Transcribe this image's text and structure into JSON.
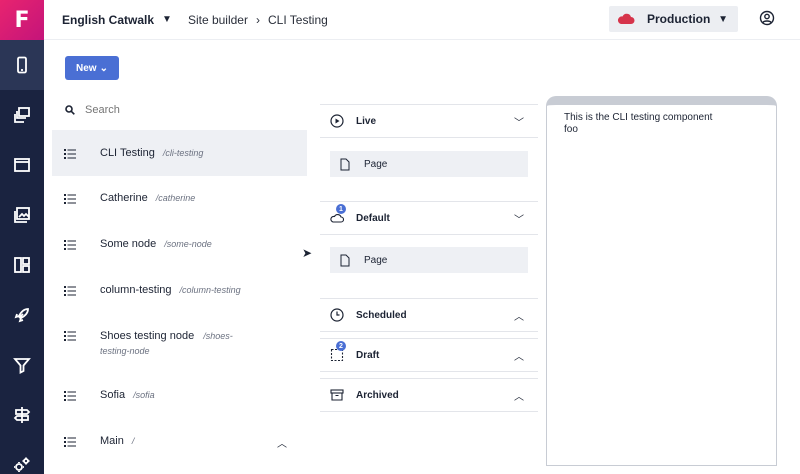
{
  "app": {
    "logo": "F"
  },
  "breadcrumb": {
    "project": "English Catwalk",
    "section": "Site builder",
    "page": "CLI Testing"
  },
  "environment": {
    "label": "Production",
    "cloud_color": "#d6344b"
  },
  "toolbar": {
    "new_label": "New"
  },
  "search": {
    "placeholder": "Search"
  },
  "nodes": [
    {
      "name": "CLI Testing",
      "path": "/cli-testing"
    },
    {
      "name": "Catherine",
      "path": "/catherine"
    },
    {
      "name": "Some node",
      "path": "/some-node"
    },
    {
      "name": "column-testing",
      "path": "/column-testing"
    },
    {
      "name": "Shoes testing node",
      "path_a": "/shoes-",
      "path_b": "testing-node"
    },
    {
      "name": "Sofia",
      "path": "/sofia"
    },
    {
      "name": "Main",
      "path": "/"
    }
  ],
  "sections": {
    "live": {
      "title": "Live",
      "page": "Page"
    },
    "default": {
      "title": "Default",
      "badge": "1",
      "page": "Page"
    },
    "scheduled": {
      "title": "Scheduled"
    },
    "draft": {
      "title": "Draft",
      "badge": "2"
    },
    "archived": {
      "title": "Archived"
    }
  },
  "preview": {
    "line1": "This is the CLI testing component",
    "line2": "foo"
  },
  "colors": {
    "rail": "#1a2340",
    "accent": "#4a6fd4",
    "logo": "#e8246f"
  }
}
